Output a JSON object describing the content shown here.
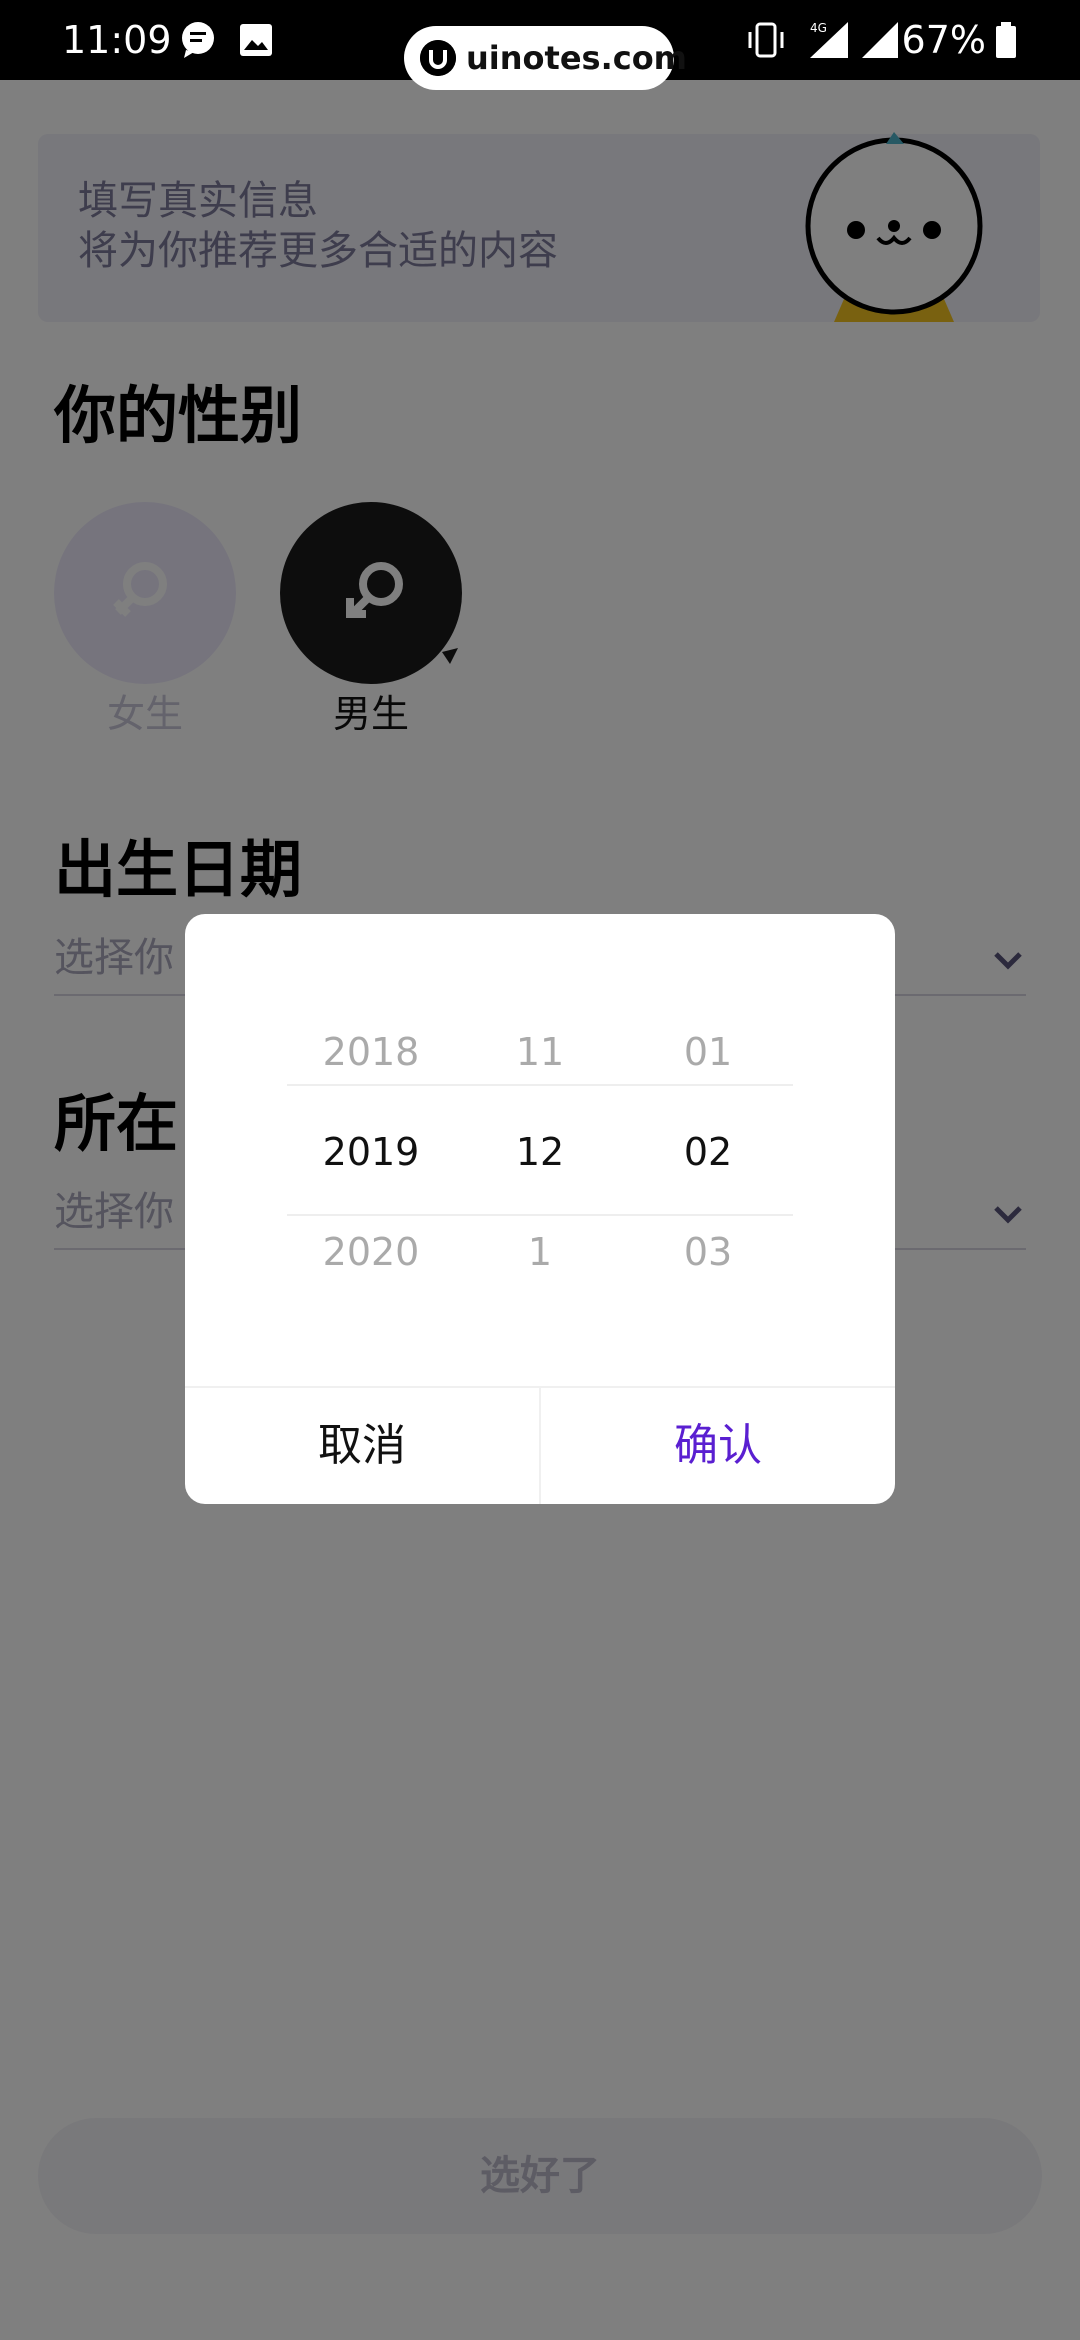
{
  "status_bar": {
    "time": "11:09",
    "battery": "67%",
    "icons": [
      "message-icon",
      "image-icon",
      "vibrate-icon",
      "4g-signal-icon",
      "signal-icon",
      "battery-icon"
    ]
  },
  "watermark": {
    "text": "uinotes.com"
  },
  "banner": {
    "line1": "填写真实信息",
    "line2": "将为你推荐更多合适的内容"
  },
  "gender_section": {
    "title": "你的性别",
    "female_label": "女生",
    "male_label": "男生",
    "selected": "男生"
  },
  "birthday_section": {
    "title": "出生日期",
    "placeholder": "选择你"
  },
  "location_section": {
    "title": "所在",
    "placeholder": "选择你"
  },
  "submit": {
    "label": "选好了"
  },
  "date_picker": {
    "years": [
      "2018",
      "2019",
      "2020"
    ],
    "months": [
      "11",
      "12",
      "1"
    ],
    "days": [
      "01",
      "02",
      "03"
    ],
    "cancel_label": "取消",
    "confirm_label": "确认",
    "accent_color": "#5a1fd1"
  }
}
